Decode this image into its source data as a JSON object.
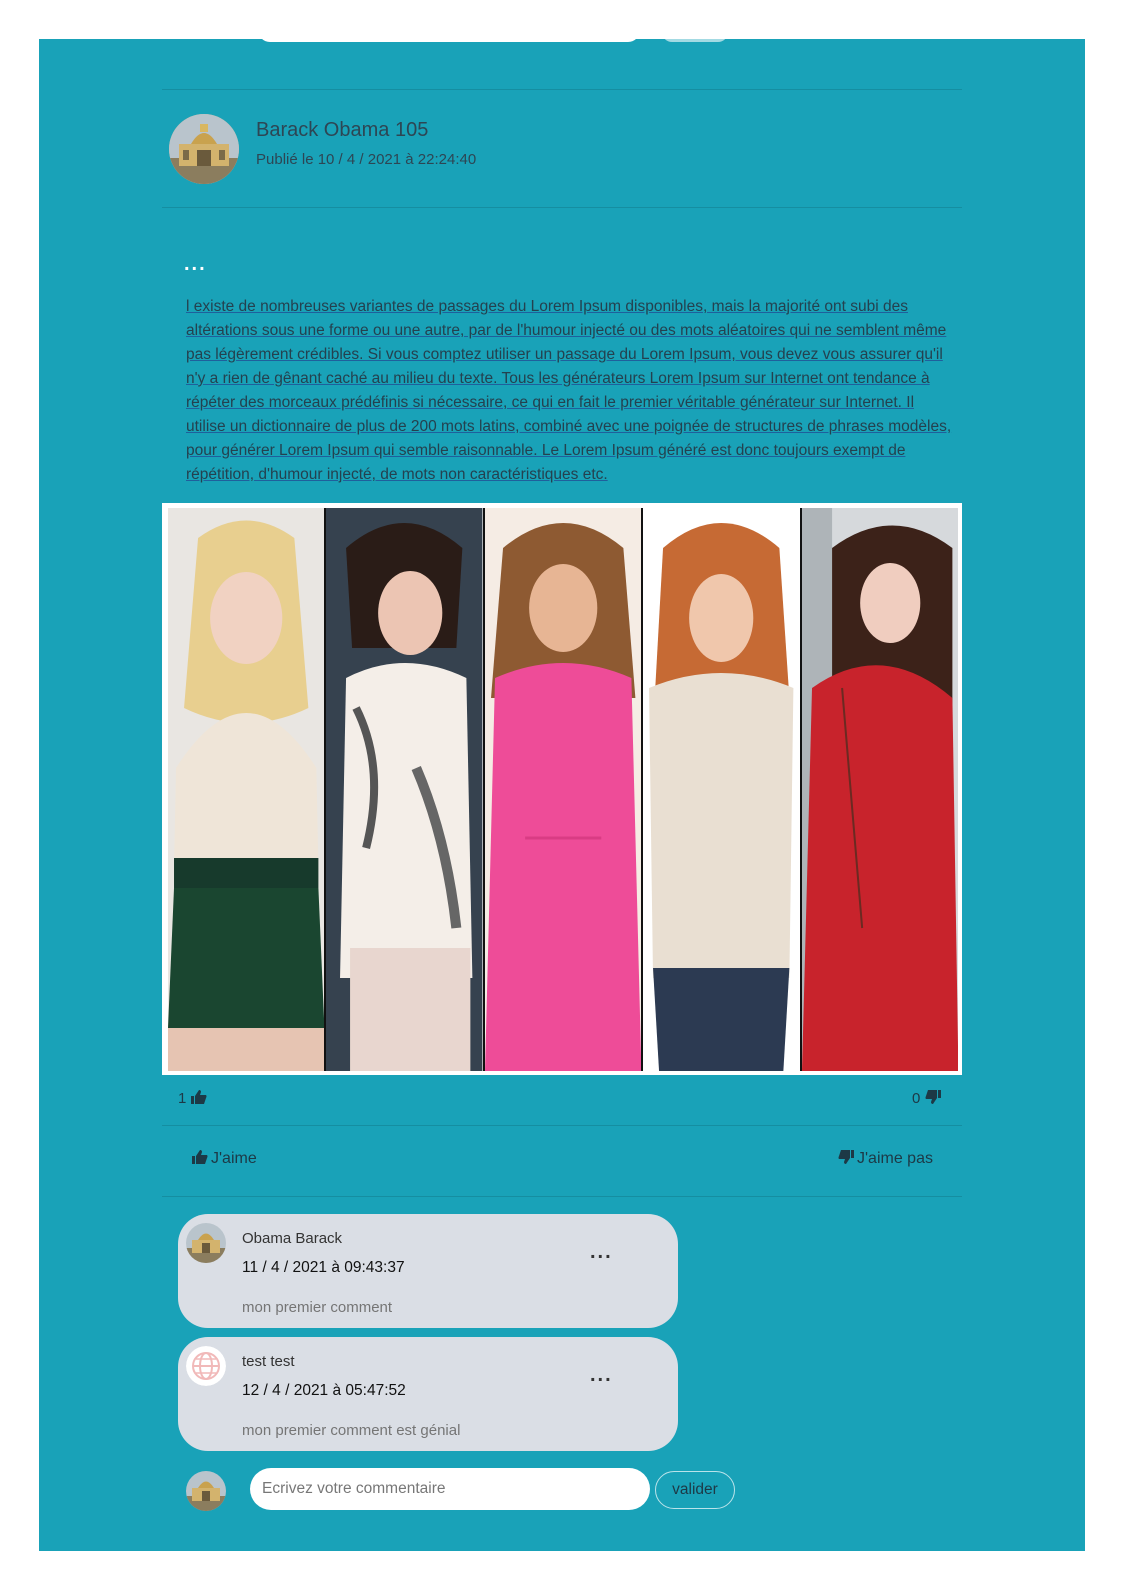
{
  "post": {
    "author": "Barack Obama 105",
    "date": "Publié le 10 / 4 / 2021 à 22:24:40",
    "menu": "...",
    "text": "l existe de nombreuses variantes de passages du Lorem Ipsum disponibles, mais la majorité ont subi des altérations sous une forme ou une autre, par de l'humour injecté ou des mots aléatoires qui ne semblent même pas légèrement crédibles. Si vous comptez utiliser un passage du Lorem Ipsum, vous devez vous assurer qu'il n'y a rien de gênant caché au milieu du texte. Tous les générateurs Lorem Ipsum sur Internet ont tendance à répéter des morceaux prédéfinis si nécessaire, ce qui en fait le premier véritable générateur sur Internet. Il utilise un dictionnaire de plus de 200 mots latins, combiné avec une poignée de structures de phrases modèles, pour générer Lorem Ipsum qui semble raisonnable. Le Lorem Ipsum généré est donc toujours exempt de répétition, d'humour injecté, de mots non caractéristiques etc."
  },
  "reactions": {
    "like_count": "1",
    "dislike_count": "0",
    "like_label": "J'aime",
    "dislike_label": "J'aime pas",
    "like_icon": "thumbs-up-icon",
    "dislike_icon": "thumbs-down-icon"
  },
  "comments": [
    {
      "name": "Obama Barack",
      "date": "11 / 4 / 2021 à 09:43:37",
      "text": "mon premier comment",
      "menu": "..."
    },
    {
      "name": "test test",
      "date": "12 / 4 / 2021 à 05:47:52",
      "text": "mon premier comment est génial",
      "menu": "..."
    }
  ],
  "composer": {
    "placeholder": "Ecrivez votre commentaire",
    "button": "valider"
  },
  "colors": {
    "background": "#19a2b8",
    "comment_bubble": "#dadee5",
    "text": "#1d3946"
  }
}
